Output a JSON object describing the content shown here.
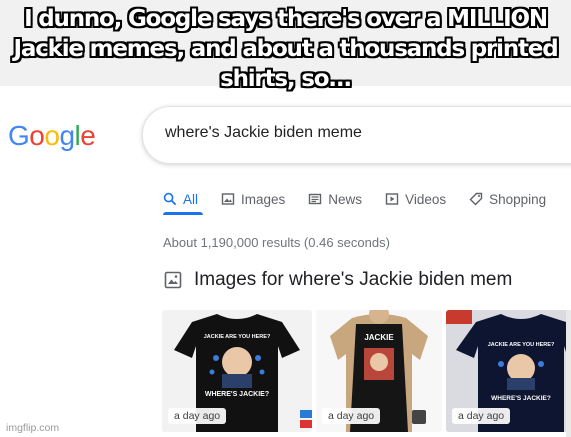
{
  "caption": "I dunno, Google says there's over a MILLION Jackie memes, and about a thousands printed shirts, so...",
  "google": {
    "logo_letters": [
      {
        "ch": "G",
        "color": "#4285F4"
      },
      {
        "ch": "o",
        "color": "#EA4335"
      },
      {
        "ch": "o",
        "color": "#FBBC05"
      },
      {
        "ch": "g",
        "color": "#4285F4"
      },
      {
        "ch": "l",
        "color": "#34A853"
      },
      {
        "ch": "e",
        "color": "#EA4335"
      }
    ],
    "query": "where's Jackie biden meme",
    "tabs": [
      {
        "label": "All",
        "icon": "search-icon",
        "active": true
      },
      {
        "label": "Images",
        "icon": "image-icon",
        "active": false
      },
      {
        "label": "News",
        "icon": "newspaper-icon",
        "active": false
      },
      {
        "label": "Videos",
        "icon": "play-icon",
        "active": false
      },
      {
        "label": "Shopping",
        "icon": "tag-icon",
        "active": false
      }
    ],
    "result_stats": "About 1,190,000 results (0.46 seconds)",
    "images_header": "Images for where's Jackie biden mem",
    "thumbnails": [
      {
        "age": "a day ago",
        "shirt_text_top": "JACKIE ARE YOU HERE?",
        "shirt_text_bottom": "WHERE'S JACKIE?"
      },
      {
        "age": "a day ago",
        "shirt_text_top": "JACKIE",
        "shirt_text_bottom": ""
      },
      {
        "age": "a day ago",
        "shirt_text_top": "JACKIE ARE YOU HERE?",
        "shirt_text_bottom": "WHERE'S JACKIE?"
      }
    ]
  },
  "watermark": "imgflip.com"
}
